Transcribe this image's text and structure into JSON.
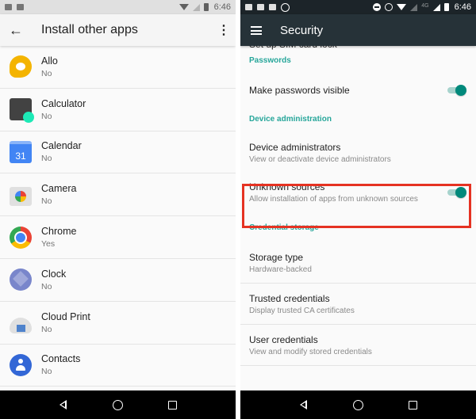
{
  "left_screen": {
    "status_bar": {
      "notification_icons": [
        "gmail-icon",
        "photos-icon"
      ],
      "system_icons": [
        "wifi-icon",
        "no-sim-icon",
        "battery-icon"
      ],
      "time": "6:46"
    },
    "app_bar": {
      "back_icon": "arrow-left",
      "title": "Install other apps",
      "overflow_icon": "more-vert"
    },
    "apps": [
      {
        "name": "Allo",
        "status": "No",
        "icon": "allo-icon"
      },
      {
        "name": "Calculator",
        "status": "No",
        "icon": "calculator-icon"
      },
      {
        "name": "Calendar",
        "status": "No",
        "icon": "calendar-icon",
        "icon_text": "31"
      },
      {
        "name": "Camera",
        "status": "No",
        "icon": "camera-icon"
      },
      {
        "name": "Chrome",
        "status": "Yes",
        "icon": "chrome-icon"
      },
      {
        "name": "Clock",
        "status": "No",
        "icon": "clock-icon"
      },
      {
        "name": "Cloud Print",
        "status": "No",
        "icon": "cloud-print-icon"
      },
      {
        "name": "Contacts",
        "status": "No",
        "icon": "contacts-icon"
      }
    ],
    "nav_bar": [
      "back",
      "home",
      "recents"
    ]
  },
  "right_screen": {
    "status_bar": {
      "notification_icons": [
        "message-icon",
        "gmail-icon",
        "photos-icon",
        "whatsapp-icon"
      ],
      "system_icons": [
        "do-not-disturb-icon",
        "alarm-icon",
        "wifi-icon",
        "signal-icon",
        "signal-icon",
        "battery-icon"
      ],
      "network_label": "4G",
      "time": "6:46"
    },
    "app_bar": {
      "menu_icon": "hamburger",
      "title": "Security"
    },
    "partially_visible_item": "Set up SIM card lock",
    "sections": [
      {
        "header": "Passwords",
        "items": [
          {
            "title": "Make passwords visible",
            "toggle": true
          }
        ]
      },
      {
        "header": "Device administration",
        "items": [
          {
            "title": "Device administrators",
            "subtitle": "View or deactivate device administrators"
          },
          {
            "title": "Unknown sources",
            "subtitle": "Allow installation of apps from unknown sources",
            "toggle": true,
            "highlighted": true
          }
        ]
      },
      {
        "header": "Credential storage",
        "items": [
          {
            "title": "Storage type",
            "subtitle": "Hardware-backed"
          },
          {
            "title": "Trusted credentials",
            "subtitle": "Display trusted CA certificates"
          },
          {
            "title": "User credentials",
            "subtitle": "View and modify stored credentials"
          }
        ]
      }
    ],
    "nav_bar": [
      "back",
      "home",
      "recents"
    ]
  },
  "colors": {
    "accent": "#009688",
    "section_header": "#26a69a",
    "highlight_box": "#e53222",
    "right_app_bar": "#263238"
  }
}
